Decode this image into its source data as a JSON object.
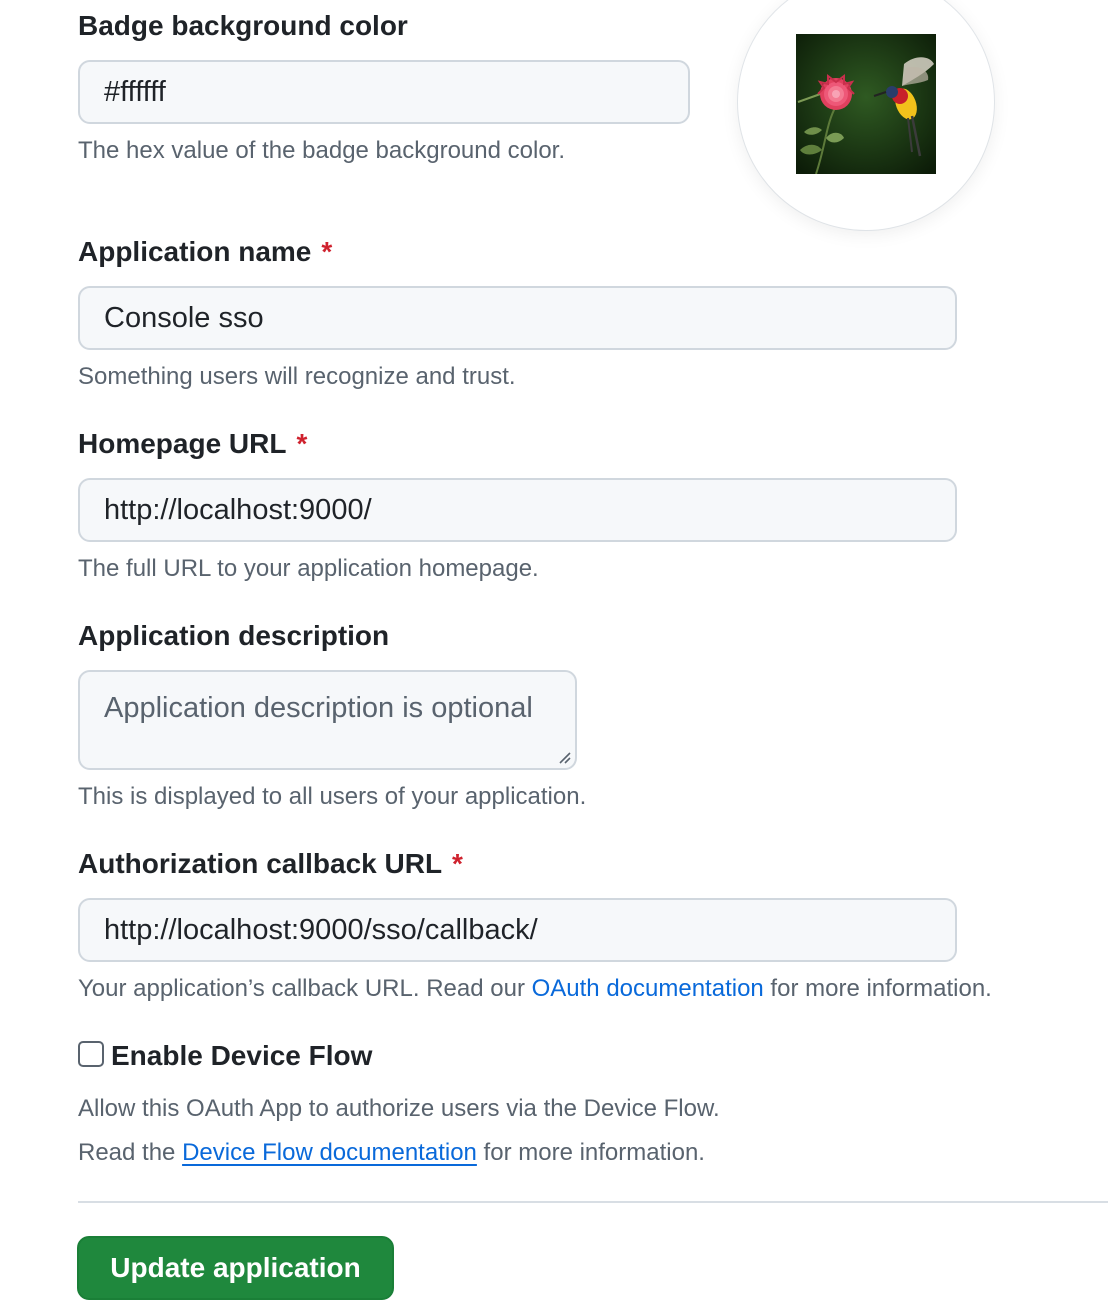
{
  "badge": {
    "label": "Badge background color",
    "value": "#ffffff",
    "note": "The hex value of the badge background color."
  },
  "logo": {
    "icon": "hummingbird-flower-image"
  },
  "app_name": {
    "label": "Application name",
    "required": "*",
    "value": "Console sso",
    "note": "Something users will recognize and trust."
  },
  "homepage": {
    "label": "Homepage URL",
    "required": "*",
    "value": "http://localhost:9000/",
    "note": "The full URL to your application homepage."
  },
  "description": {
    "label": "Application description",
    "placeholder": "Application description is optional",
    "value": "",
    "note": "This is displayed to all users of your application."
  },
  "callback": {
    "label": "Authorization callback URL",
    "required": "*",
    "value": "http://localhost:9000/sso/callback/",
    "note_before": "Your application’s callback URL. Read our ",
    "note_link": "OAuth documentation",
    "note_after": " for more information."
  },
  "device_flow": {
    "label": "Enable Device Flow",
    "checked": false,
    "note1": "Allow this OAuth App to authorize users via the Device Flow.",
    "note2_before": "Read the ",
    "note2_link": "Device Flow documentation",
    "note2_after": " for more information."
  },
  "submit": {
    "label": "Update application"
  },
  "colors": {
    "accent": "#1f883d",
    "link": "#0969da",
    "required": "#cf222e"
  }
}
